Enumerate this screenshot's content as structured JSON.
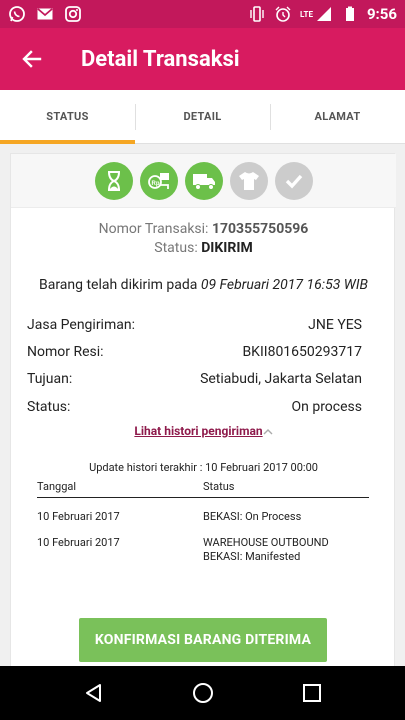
{
  "status_bar": {
    "time": "9:56",
    "network": "LTE",
    "left_icons": [
      "whatsapp-icon",
      "gmail-icon",
      "instagram-icon"
    ],
    "right_icons": [
      "vibrate-icon",
      "alarm-icon",
      "signal-icon",
      "battery-icon"
    ]
  },
  "appbar": {
    "title": "Detail Transaksi",
    "back_icon": "arrow-back-icon"
  },
  "tabs": [
    {
      "label": "STATUS",
      "active": true
    },
    {
      "label": "DETAIL",
      "active": false
    },
    {
      "label": "ALAMAT",
      "active": false
    }
  ],
  "progress_steps": [
    {
      "icon": "hourglass-icon",
      "state": "done"
    },
    {
      "icon": "payment-icon",
      "state": "done"
    },
    {
      "icon": "truck-icon",
      "state": "done"
    },
    {
      "icon": "shirt-icon",
      "state": "todo"
    },
    {
      "icon": "check-icon",
      "state": "todo"
    }
  ],
  "transaction": {
    "number_label": "Nomor Transaksi:",
    "number_value": "170355750596",
    "status_label": "Status:",
    "status_value": "DIKIRIM"
  },
  "shipped": {
    "prefix": "Barang telah dikirim pada ",
    "datetime": "09 Februari 2017 16:53 WIB"
  },
  "details": [
    {
      "label": "Jasa Pengiriman:",
      "value": "JNE YES"
    },
    {
      "label": "Nomor Resi:",
      "value": "BKII801650293717"
    },
    {
      "label": "Tujuan:",
      "value": "Setiabudi, Jakarta Selatan"
    },
    {
      "label": "Status:",
      "value": "On process"
    }
  ],
  "history_link": "Lihat histori pengiriman",
  "history_updated": "Update histori terakhir : 10 Februari 2017 00:00",
  "history_table": {
    "headers": [
      "Tanggal",
      "Status"
    ],
    "rows": [
      {
        "date": "10 Februari 2017",
        "status_line1": "BEKASI: On Process",
        "status_line2": ""
      },
      {
        "date": "10 Februari 2017",
        "status_line1": "WAREHOUSE OUTBOUND",
        "status_line2": "BEKASI: Manifested"
      }
    ]
  },
  "confirm_button": "KONFIRMASI BARANG DITERIMA",
  "colors": {
    "status_bar": "#c2185b",
    "appbar": "#d81b60",
    "tab_indicator": "#f5a623",
    "step_done": "#6cc04a",
    "step_todo": "#cccccc",
    "confirm": "#7ac15a",
    "link": "#8e1a4b"
  }
}
